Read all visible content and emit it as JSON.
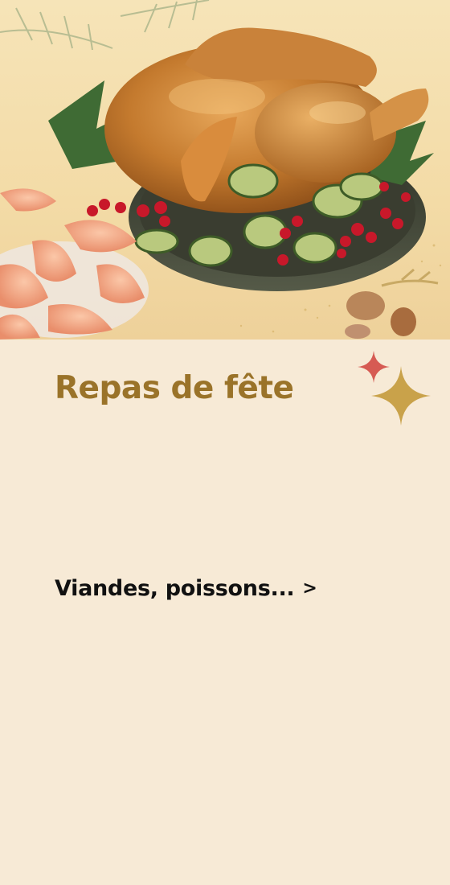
{
  "card": {
    "title": "Repas de fête",
    "link_label": "Viandes, poissons...",
    "chevron": ">"
  },
  "hero": {
    "icon": "roast-chicken-photo",
    "description_icons": [
      "roast-chicken",
      "shrimp",
      "cranberries",
      "zucchini-ribbons",
      "pine-branch",
      "almonds"
    ]
  },
  "colors": {
    "background": "#f7ead6",
    "title": "#9a7329",
    "link": "#111111",
    "sparkle_gold": "#c9a24a",
    "sparkle_red": "#d65b53"
  }
}
